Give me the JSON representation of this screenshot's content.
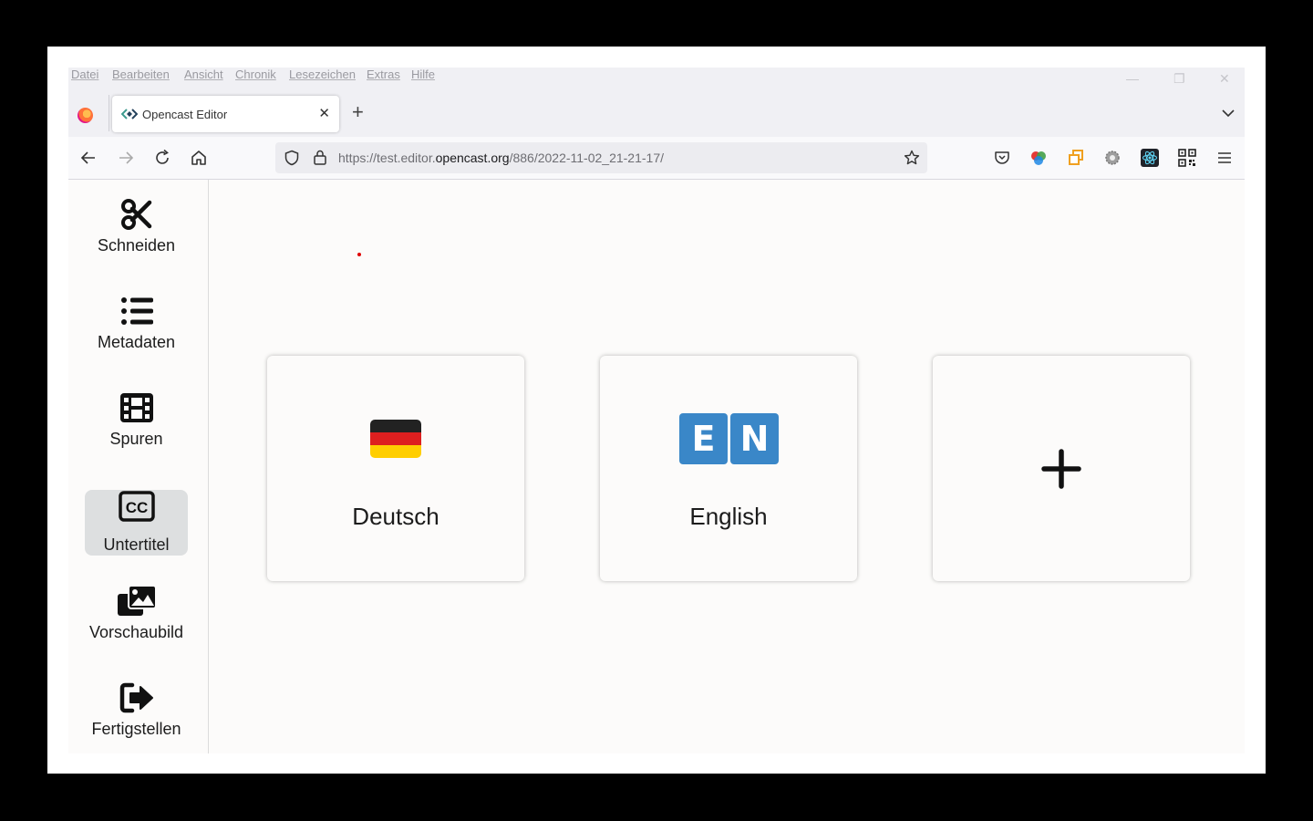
{
  "menubar": {
    "items": [
      "Datei",
      "Bearbeiten",
      "Ansicht",
      "Chronik",
      "Lesezeichen",
      "Extras",
      "Hilfe"
    ]
  },
  "window_controls": {
    "minimize": "—",
    "restore": "❐",
    "close": "✕"
  },
  "tab": {
    "title": "Opencast Editor",
    "close": "✕"
  },
  "new_tab": "+",
  "urlbar": {
    "prefix": "https://test.editor.",
    "host": "opencast.org",
    "path": "/886/2022-11-02_21-21-17/"
  },
  "sidebar": {
    "items": [
      {
        "label": "Schneiden",
        "icon": "scissors-icon",
        "active": false
      },
      {
        "label": "Metadaten",
        "icon": "list-icon",
        "active": false
      },
      {
        "label": "Spuren",
        "icon": "film-icon",
        "active": false
      },
      {
        "label": "Untertitel",
        "icon": "closed-captions-icon",
        "active": true
      },
      {
        "label": "Vorschaubild",
        "icon": "images-icon",
        "active": false
      },
      {
        "label": "Fertigstellen",
        "icon": "sign-out-icon",
        "active": false
      }
    ]
  },
  "cards": [
    {
      "label": "Deutsch",
      "icon": "german-flag-icon"
    },
    {
      "label": "English",
      "icon": "en-badge-icon",
      "badge_letters": [
        "E",
        "N"
      ]
    },
    {
      "label": "",
      "icon": "plus-icon"
    }
  ],
  "colors": {
    "accent_en_badge": "#3a87c8",
    "active_nav_bg": "#dddfe0"
  }
}
